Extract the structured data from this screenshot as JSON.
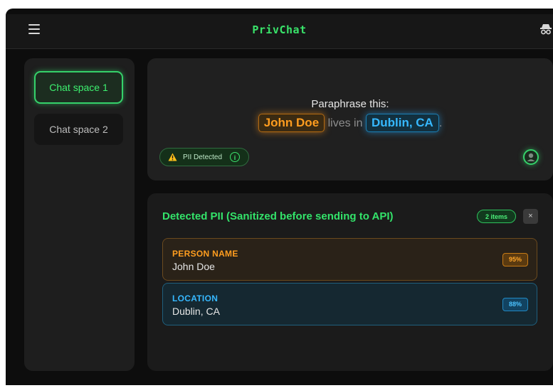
{
  "app": {
    "title": "PrivChat"
  },
  "sidebar": {
    "items": [
      {
        "label": "Chat space 1",
        "active": true
      },
      {
        "label": "Chat space 2",
        "active": false
      }
    ]
  },
  "message": {
    "prompt": "Paraphrase this:",
    "segments": {
      "person": "John Doe",
      "mid": " lives in ",
      "location": "Dublin, CA",
      "end": "."
    },
    "pii_badge": "PII Detected",
    "info_icon": "i"
  },
  "pii_panel": {
    "title": "Detected PII (Sanitized before sending to API)",
    "count": "2 items",
    "close": "×",
    "items": [
      {
        "type": "PERSON NAME",
        "value": "John Doe",
        "confidence": "95%",
        "color": "#ff9d1f"
      },
      {
        "type": "LOCATION",
        "value": "Dublin, CA",
        "confidence": "88%",
        "color": "#36b8ff"
      }
    ]
  },
  "icons": {
    "menu": "hamburger-menu-icon",
    "top_right": "incognito-icon",
    "warning": "warning-icon",
    "avatar": "user-avatar-icon"
  },
  "colors": {
    "accent": "#35d16a",
    "person": "#ff9d1f",
    "location": "#36b8ff"
  }
}
